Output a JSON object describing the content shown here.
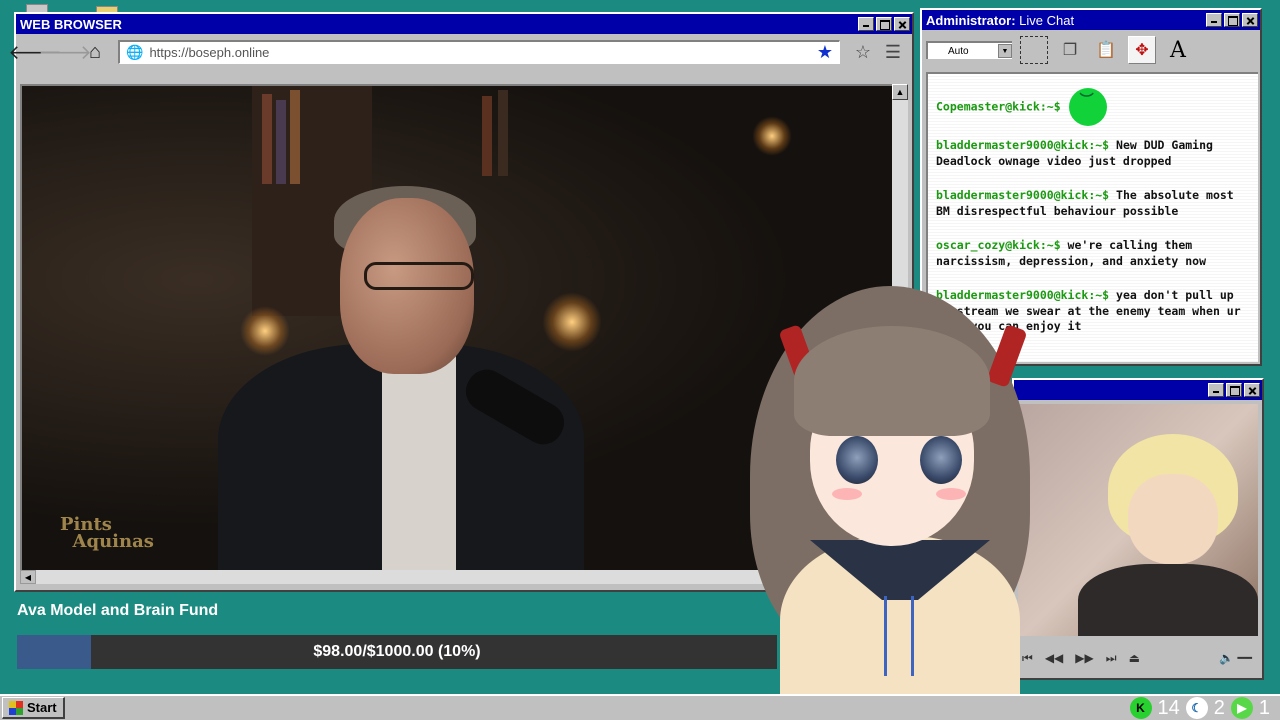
{
  "browser": {
    "title": "WEB BROWSER",
    "url": "https://boseph.online",
    "video_watermark": "Pints with Aquinas"
  },
  "chat": {
    "title_bold": "Administrator:",
    "title_rest": " Live Chat",
    "zoom_select": "Auto",
    "messages": [
      {
        "user": "Copemaster@kick:~$",
        "text": ""
      },
      {
        "user": "bladdermaster9000@kick:~$",
        "text": " New DUD Gaming Deadlock ownage video just dropped"
      },
      {
        "user": "bladdermaster9000@kick:~$",
        "text": " The absolute most BM disrespectful behaviour possible"
      },
      {
        "user": "oscar_cozy@kick:~$",
        "text": " we're calling them narcissism, depression, and anxiety now"
      },
      {
        "user": "bladdermaster9000@kick:~$",
        "text": " yea don't pull up on stream we swear at the enemy team when ur done you can enjoy it"
      }
    ]
  },
  "fund": {
    "title": "Ava Model and Brain Fund",
    "progress_text": "$98.00/$1000.00 (10%)",
    "progress_fraction": 0.098
  },
  "taskbar": {
    "start_label": "Start",
    "tray_count_a": "14",
    "tray_count_b": "2",
    "tray_count_c": "1"
  },
  "colors": {
    "desktop": "#1b8a80",
    "titlebar": "#0000a8",
    "chat_user": "#1a9a10",
    "fund_fill": "#3a5a8c"
  }
}
